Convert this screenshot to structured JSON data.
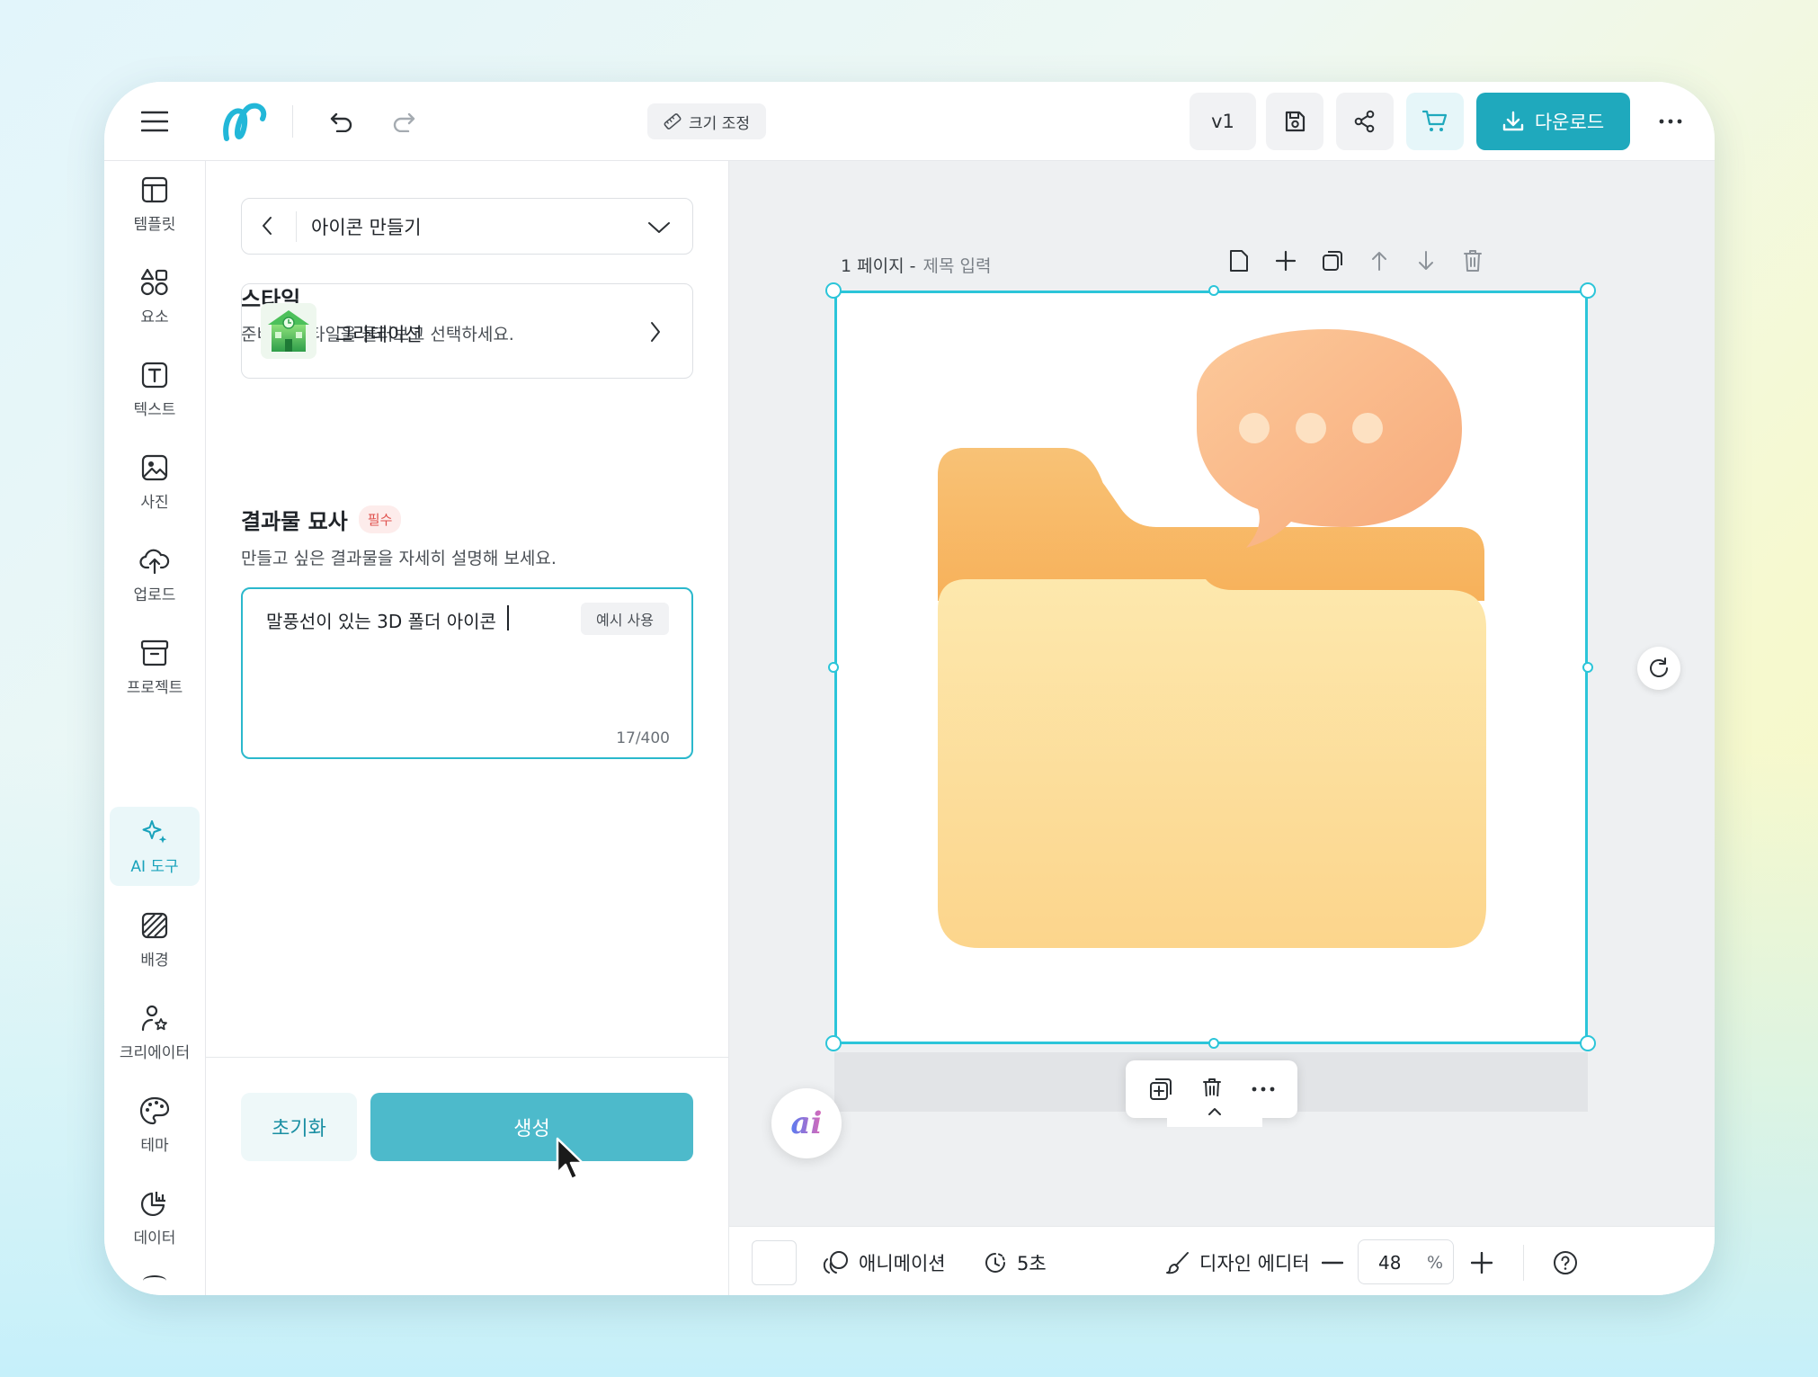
{
  "topbar": {
    "resize_label": "크기 조정",
    "version_label": "v1",
    "download_label": "다운로드"
  },
  "rail": {
    "items": [
      {
        "label": "템플릿",
        "icon": "template-icon"
      },
      {
        "label": "요소",
        "icon": "elements-icon"
      },
      {
        "label": "텍스트",
        "icon": "text-icon"
      },
      {
        "label": "사진",
        "icon": "photo-icon"
      },
      {
        "label": "업로드",
        "icon": "upload-icon"
      },
      {
        "label": "프로젝트",
        "icon": "project-icon"
      },
      {
        "label": "AI 도구",
        "icon": "ai-tools-icon",
        "active": true
      },
      {
        "label": "배경",
        "icon": "background-icon"
      },
      {
        "label": "크리에이터",
        "icon": "creator-icon"
      },
      {
        "label": "테마",
        "icon": "theme-icon"
      },
      {
        "label": "데이터",
        "icon": "data-icon"
      }
    ]
  },
  "panel": {
    "tool_title": "아이콘 만들기",
    "style_heading": "스타일",
    "style_desc": "준비된 스타일을 둘러보고 선택하세요.",
    "style_name": "그라데이션",
    "desc_heading": "결과물 묘사",
    "required_badge": "필수",
    "desc_sub": "만들고 싶은 결과물을 자세히 설명해 보세요.",
    "prompt_value": "말풍선이 있는 3D 폴더 아이콘",
    "example_button": "예시 사용",
    "char_count": "17/400",
    "reset_label": "초기화",
    "generate_label": "생성"
  },
  "canvas": {
    "page_label": "1 페이지 -",
    "title_placeholder": "제목 입력",
    "ai_badge": "ai"
  },
  "bottombar": {
    "animation_label": "애니메이션",
    "duration_label": "5초",
    "design_editor_label": "디자인 에디터",
    "zoom_value": "48",
    "zoom_unit": "%"
  },
  "colors": {
    "accent": "#2bb8cc",
    "download_bg": "#1fa9bd",
    "generate_bg": "#4dbacb",
    "required": "#e0514d"
  }
}
